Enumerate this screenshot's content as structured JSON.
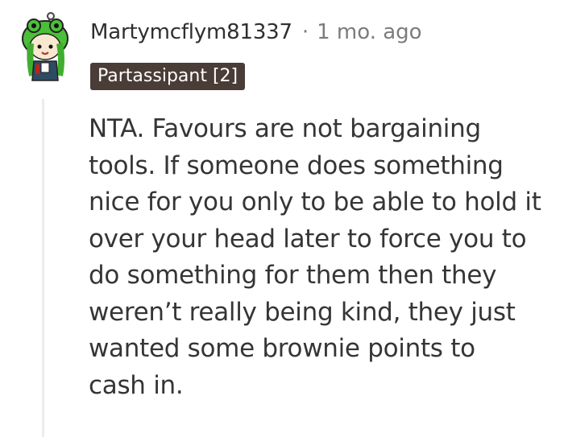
{
  "comment": {
    "author": "Martymcflym81337",
    "separator": "·",
    "timestamp": "1 mo. ago",
    "flair": "Partassipant [2]",
    "avatar_icon": "snoo-avatar-icon",
    "body_lines": [
      "NTA. Favours are not bargaining",
      "tools. If someone does something",
      "nice for you only to be able to hold it",
      "over your head later to force you to",
      "do something for them then they",
      "weren’t really being kind, they just",
      "wanted some brownie points to",
      "cash in."
    ]
  }
}
